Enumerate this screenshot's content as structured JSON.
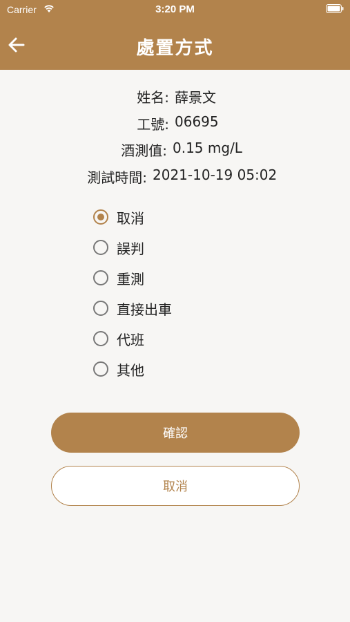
{
  "status_bar": {
    "carrier": "Carrier",
    "time": "3:20 PM"
  },
  "nav": {
    "title": "處置方式",
    "back_icon": "arrow-left-icon"
  },
  "info": {
    "name_label": "姓名:",
    "name_value": "薛景文",
    "id_label": "工號:",
    "id_value": "06695",
    "alcohol_label": "酒測值:",
    "alcohol_value": "0.15 mg/L",
    "time_label": "測試時間:",
    "time_value": "2021-10-19 05:02"
  },
  "options": [
    {
      "label": "取消",
      "selected": true
    },
    {
      "label": "誤判",
      "selected": false
    },
    {
      "label": "重測",
      "selected": false
    },
    {
      "label": "直接出車",
      "selected": false
    },
    {
      "label": "代班",
      "selected": false
    },
    {
      "label": "其他",
      "selected": false
    }
  ],
  "buttons": {
    "confirm_label": "確認",
    "cancel_label": "取消"
  },
  "colors": {
    "accent": "#b2834c",
    "background": "#f7f6f4"
  }
}
